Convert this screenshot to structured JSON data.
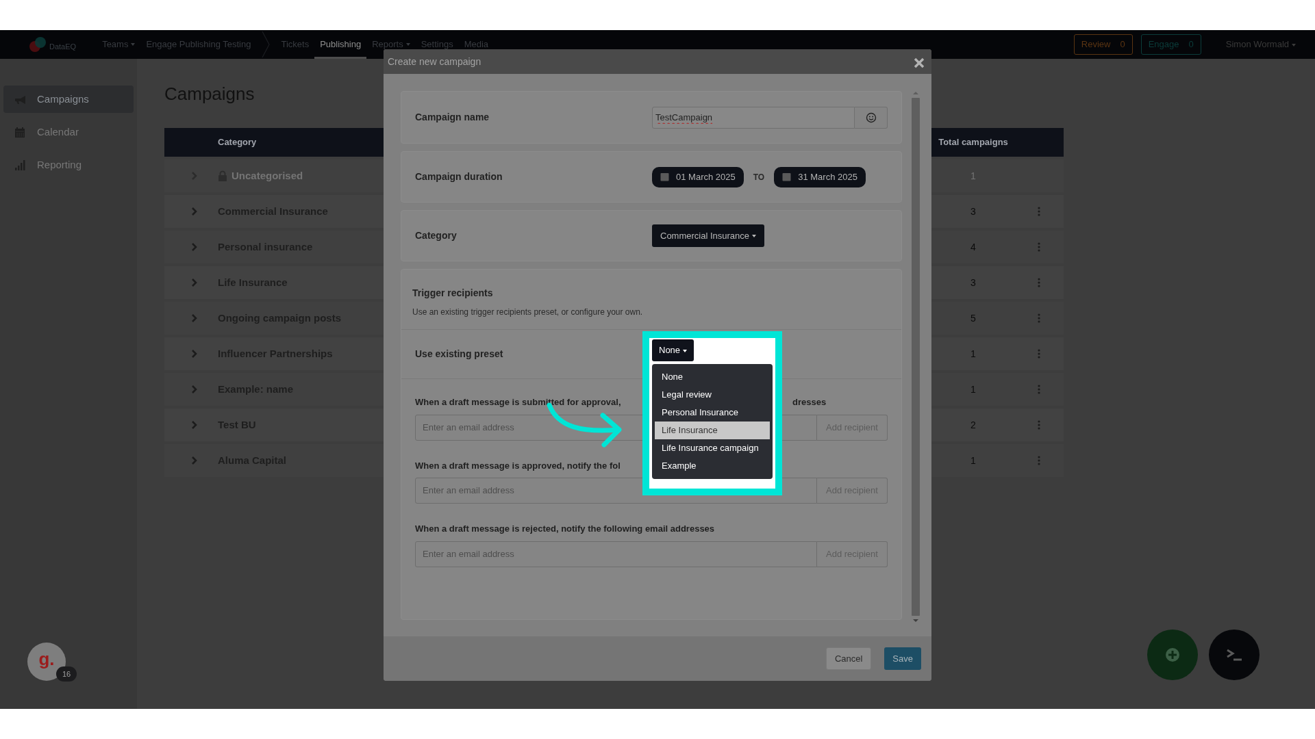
{
  "navbar": {
    "logo": "DataEQ",
    "items": [
      {
        "label": "Teams",
        "kind": "dropdown",
        "selected": false
      },
      {
        "label": "Engage Publishing Testing",
        "kind": "crumb",
        "selected": false
      },
      {
        "label": "Tickets",
        "kind": "link",
        "selected": false
      },
      {
        "label": "Publishing",
        "kind": "link",
        "selected": true
      },
      {
        "label": "Reports",
        "kind": "dropdown",
        "selected": false
      },
      {
        "label": "Settings",
        "kind": "link",
        "selected": false
      },
      {
        "label": "Media",
        "kind": "link",
        "selected": false
      }
    ],
    "counters": [
      {
        "label": "Review",
        "count": "0",
        "color": "#5a3412"
      },
      {
        "label": "Engage",
        "count": "0",
        "color": "#0b3c3a"
      }
    ],
    "user": "Simon Wormald"
  },
  "sidebar": {
    "items": [
      {
        "label": "Campaigns",
        "selected": true
      },
      {
        "label": "Calendar",
        "selected": false
      },
      {
        "label": "Reporting",
        "selected": false
      }
    ]
  },
  "page": {
    "title": "Campaigns"
  },
  "table": {
    "columns": [
      "Category",
      "Total campaigns"
    ],
    "rows": [
      {
        "category": "Uncategorised",
        "total": "1",
        "locked": true
      },
      {
        "category": "Commercial Insurance",
        "total": "3",
        "locked": false
      },
      {
        "category": "Personal insurance",
        "total": "4",
        "locked": false
      },
      {
        "category": "Life Insurance",
        "total": "3",
        "locked": false
      },
      {
        "category": "Ongoing campaign posts",
        "total": "5",
        "locked": false
      },
      {
        "category": "Influencer Partnerships",
        "total": "1",
        "locked": false
      },
      {
        "category": "Example: name",
        "total": "1",
        "locked": false
      },
      {
        "category": "Test BU",
        "total": "2",
        "locked": false
      },
      {
        "category": "Aluma Capital",
        "total": "1",
        "locked": false
      }
    ]
  },
  "modal": {
    "title": "Create new campaign",
    "campaign_name": {
      "label": "Campaign name",
      "value": "TestCampaign"
    },
    "duration": {
      "label": "Campaign duration",
      "start": "01 March 2025",
      "separator": "TO",
      "end": "31 March 2025"
    },
    "category": {
      "label": "Category",
      "value": "Commercial Insurance"
    },
    "trigger": {
      "title": "Trigger recipients",
      "description": "Use an existing trigger recipients preset, or configure your own.",
      "preset_label": "Use existing preset",
      "preset_value": "None",
      "preset_options": [
        {
          "label": "None",
          "selected": false
        },
        {
          "label": "Legal review",
          "selected": false
        },
        {
          "label": "Personal Insurance",
          "selected": false
        },
        {
          "label": "Life Insurance",
          "selected": true
        },
        {
          "label": "Life Insurance campaign",
          "selected": false
        },
        {
          "label": "Example",
          "selected": false
        }
      ],
      "notify": [
        {
          "label": "When a draft message is submitted for approval,",
          "label_tail": "dresses",
          "placeholder": "Enter an email address",
          "button": "Add recipient"
        },
        {
          "label": "When a draft message is approved, notify the fol",
          "placeholder": "Enter an email address",
          "button": "Add recipient"
        },
        {
          "label": "When a draft message is rejected, notify the following email addresses",
          "placeholder": "Enter an email address",
          "button": "Add recipient"
        }
      ]
    },
    "buttons": [
      {
        "label": "Cancel",
        "kind": "secondary"
      },
      {
        "label": "Save",
        "kind": "primary"
      }
    ]
  },
  "avatar": {
    "initial": "g.",
    "badge": "16"
  }
}
